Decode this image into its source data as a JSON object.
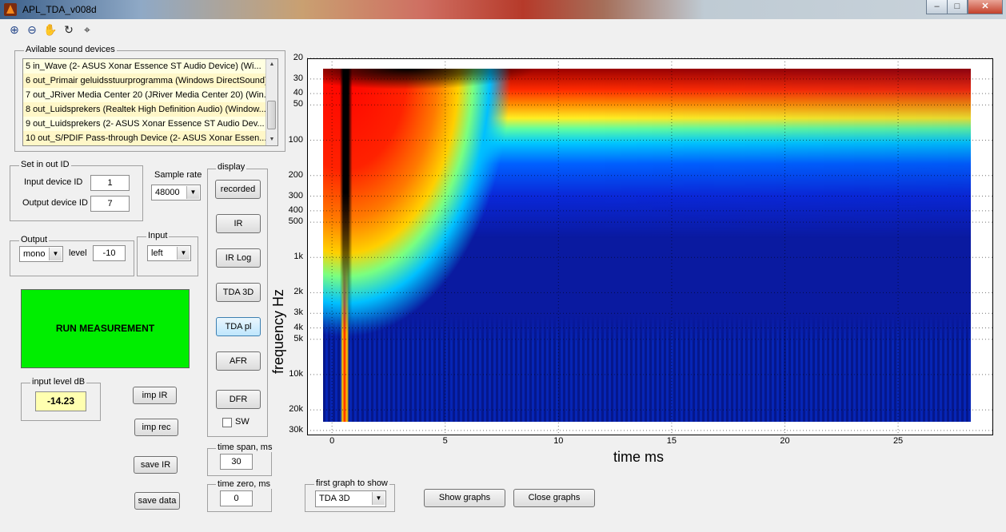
{
  "window": {
    "title": "APL_TDA_v008d",
    "controls": [
      "–",
      "□",
      "✕"
    ]
  },
  "toolbar": {
    "tools": [
      "zoom-in-icon",
      "zoom-out-icon",
      "pan-hand-icon",
      "rotate-icon",
      "data-cursor-icon"
    ]
  },
  "devices": {
    "legend": "Avilable sound devices",
    "items": [
      "5 in_Wave (2- ASUS Xonar Essence ST Audio Device) (Wi...",
      "6 out_Primair geluidsstuurprogramma (Windows DirectSound)",
      "7 out_JRiver Media Center 20 (JRiver Media Center 20) (Win...",
      "8 out_Luidsprekers (Realtek High Definition Audio) (Window...",
      "9 out_Luidsprekers (2- ASUS Xonar Essence ST Audio Dev...",
      "10 out_S/PDIF Pass-through Device (2- ASUS Xonar Essen..."
    ]
  },
  "io_ids": {
    "legend": "Set in out ID",
    "input_label": "Input device ID",
    "input_value": "1",
    "output_label": "Output device ID",
    "output_value": "7"
  },
  "sample_rate": {
    "label": "Sample rate",
    "value": "48000"
  },
  "output": {
    "legend": "Output",
    "mode": "mono",
    "level_label": "level",
    "level_value": "-10"
  },
  "input": {
    "legend": "Input",
    "channel": "left"
  },
  "run_label": "RUN MEASUREMENT",
  "input_level": {
    "legend": "input level dB",
    "value": "-14.23"
  },
  "file_buttons": {
    "imp_ir": "imp IR",
    "imp_rec": "imp rec",
    "save_ir": "save IR",
    "save_data": "save data"
  },
  "display": {
    "legend": "display",
    "buttons": [
      "recorded",
      "IR",
      "IR Log",
      "TDA 3D",
      "TDA pl",
      "AFR",
      "DFR"
    ],
    "active": "TDA pl",
    "sw_label": "SW"
  },
  "time_span": {
    "legend": "time span, ms",
    "value": "30"
  },
  "time_zero": {
    "legend": "time zero, ms",
    "value": "0"
  },
  "first_graph": {
    "legend": "first graph to show",
    "value": "TDA 3D"
  },
  "graph_buttons": {
    "show": "Show graphs",
    "close": "Close graphs"
  },
  "chart_data": {
    "type": "heatmap",
    "xlabel": "time   ms",
    "ylabel": "frequency   Hz",
    "x_ticks": [
      0,
      5,
      10,
      15,
      20,
      25
    ],
    "xlim": [
      -1.1,
      29.2
    ],
    "y_scale": "log",
    "y_inverted": true,
    "y_ticks": [
      20,
      30,
      40,
      50,
      100,
      200,
      300,
      400,
      500,
      1000,
      2000,
      3000,
      4000,
      5000,
      10000,
      20000,
      30000
    ],
    "y_tick_labels": [
      "20",
      "30",
      "40",
      "50",
      "100",
      "200",
      "300",
      "400",
      "500",
      "1k",
      "2k",
      "3k",
      "4k",
      "5k",
      "10k",
      "20k",
      "30k"
    ],
    "ylim": [
      20,
      33000
    ],
    "colormap": "jet",
    "grid": "dotted",
    "colors": {
      "low": "#00008f",
      "high": "#800000",
      "peak": "#000000"
    }
  }
}
